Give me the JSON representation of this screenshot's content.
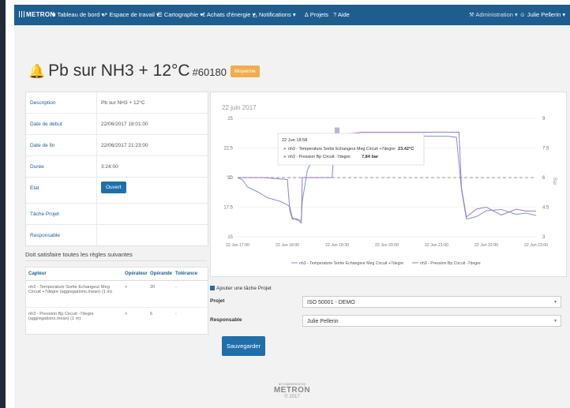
{
  "nav": {
    "brand": "METRON",
    "items": [
      "Tableau de bord",
      "Espace de travail",
      "Cartographie",
      "Achats d'énergie",
      "Notifications",
      "Projets",
      "Aide"
    ],
    "admin": "Administration",
    "user": "Julie Pellerin"
  },
  "page": {
    "title": "Pb sur NH3 + 12°C",
    "id": "#60180",
    "badge": "Moyenne"
  },
  "info": {
    "rows": [
      {
        "label": "Description",
        "value": "Pb sur NH3 + 12°C"
      },
      {
        "label": "Date de début",
        "value": "22/06/2017 18:01:00"
      },
      {
        "label": "Date de fin",
        "value": "22/06/2017 21:23:00"
      },
      {
        "label": "Durée",
        "value": "3:24:00"
      },
      {
        "label": "Etat",
        "value": "Ouvert"
      },
      {
        "label": "Tâche Projet",
        "value": ""
      },
      {
        "label": "Responsable",
        "value": ""
      }
    ]
  },
  "rules": {
    "title": "Doit satisfaire toutes les règles suivantes",
    "headers": [
      "Capteur",
      "Opérateur",
      "Opérande",
      "Tolérance"
    ],
    "rows": [
      {
        "capteur": "nh3 - Temperature Sortie Echangeur Meg Circuit +7degre (aggregations.mean) (1 m)",
        "op": ">",
        "operande": "20",
        "tol": "-"
      },
      {
        "capteur": "nh3 - Pression Bp Circuit -7degre (aggregations.mean) (1 m)",
        "op": ">",
        "operande": "6",
        "tol": "-"
      }
    ]
  },
  "chart": {
    "date_title": "22 juin 2017",
    "tooltip": {
      "time": "22 Jun 18:58",
      "line1_label": "nh3 - Temperature Sortie Echangeur Meg Circuit +7degre:",
      "line1_value": "23.42°C",
      "line2_label": "nh3 - Pression Bp Circuit -7degre:",
      "line2_value": "7.84 bar"
    },
    "left_axis_label": "°C",
    "right_axis_label": "Bar"
  },
  "chart_data": {
    "type": "line",
    "x_ticks": [
      "22 Jun 17:00",
      "22 Jun 18:00",
      "22 Jun 18:30",
      "22 Jun 20:00",
      "22 Jun 21:00",
      "22 Jun 22:00",
      "22 Jun 23:00"
    ],
    "y_left_ticks": [
      "25",
      "22.5",
      "20",
      "17.5",
      "15"
    ],
    "y_right_ticks": [
      "9",
      "7.5",
      "6",
      "4.5",
      "3"
    ],
    "ylim_left": [
      15,
      25
    ],
    "ylim_right": [
      3,
      9
    ],
    "threshold_left": 20,
    "threshold_right": 6,
    "series": [
      {
        "name": "nh3 - Temperature Sortie Echangeur Meg Circuit +7degre",
        "color": "#7f94c9",
        "axis": "left",
        "x": [
          0,
          0.1,
          0.2,
          0.4,
          0.6,
          0.85,
          1.0,
          1.05,
          1.1,
          1.2,
          1.28,
          1.3,
          1.4,
          1.55,
          1.7,
          1.85,
          2.0,
          2.5,
          3.0,
          3.5,
          4.0,
          4.2,
          4.4,
          4.5,
          4.6,
          4.8,
          5.0,
          5.3,
          5.6,
          5.8,
          6.0
        ],
        "y": [
          20.0,
          19.8,
          19.2,
          18.8,
          18.3,
          18.0,
          17.7,
          17.5,
          16.6,
          16.4,
          16.4,
          18.0,
          20.6,
          22.0,
          22.9,
          23.3,
          23.4,
          23.5,
          23.5,
          23.5,
          23.5,
          23.5,
          23.4,
          19.0,
          16.5,
          16.7,
          17.2,
          17.3,
          16.9,
          17.0,
          16.8
        ]
      },
      {
        "name": "nh3 - Pression Bp Circuit -7degre",
        "color": "#9b7ac6",
        "axis": "right",
        "x": [
          0,
          0.5,
          1.0,
          1.05,
          1.1,
          1.2,
          1.28,
          1.3,
          1.5,
          1.9,
          1.95,
          2.0,
          2.1,
          2.2,
          2.5,
          3.0,
          3.5,
          4.0,
          4.2,
          4.4,
          4.45,
          4.5,
          4.6,
          4.8,
          5.0,
          5.3,
          5.6,
          5.8,
          6.0
        ],
        "y": [
          6.0,
          6.0,
          5.9,
          4.3,
          3.9,
          3.9,
          3.7,
          6.0,
          6.0,
          6.0,
          7.8,
          7.8,
          8.0,
          8.2,
          8.3,
          8.3,
          8.3,
          8.3,
          8.3,
          8.3,
          8.3,
          5.5,
          4.0,
          4.4,
          4.5,
          4.1,
          4.4,
          4.3,
          4.3
        ]
      }
    ]
  },
  "form": {
    "checkbox_label": "Ajouter une tâche Projet",
    "projet_label": "Projet",
    "projet_value": "ISO 50001 - DEMO",
    "responsable_label": "Responsable",
    "responsable_value": "Julie Pellerin",
    "save_label": "Sauvegarder"
  },
  "footer": {
    "powered": "an experience by",
    "brand": "METRON",
    "year": "© 2017"
  }
}
